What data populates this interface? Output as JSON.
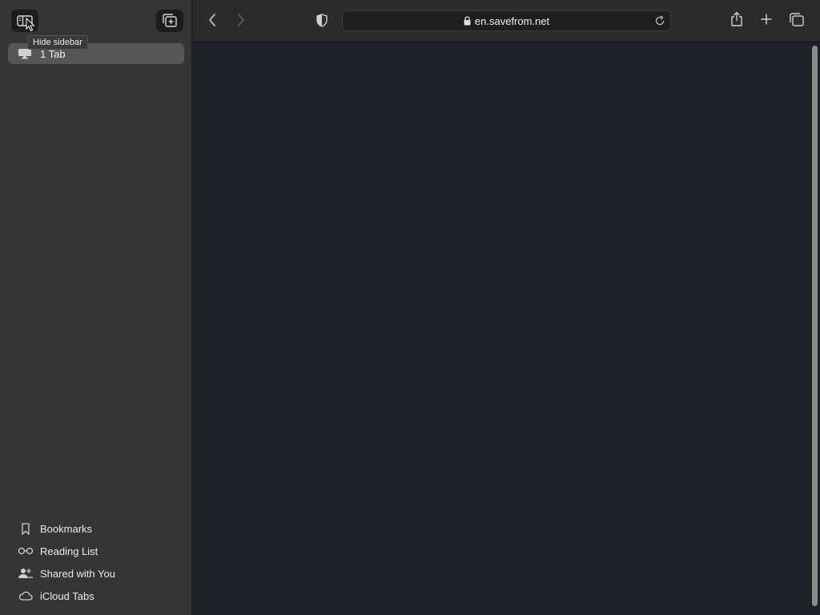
{
  "sidebar": {
    "tooltip": "Hide sidebar",
    "tab_group_label": "1 Tab",
    "items": [
      {
        "label": "Bookmarks",
        "icon": "bookmark-icon"
      },
      {
        "label": "Reading List",
        "icon": "reading-list-icon"
      },
      {
        "label": "Shared with You",
        "icon": "shared-with-you-icon"
      },
      {
        "label": "iCloud Tabs",
        "icon": "icloud-icon"
      }
    ]
  },
  "toolbar": {
    "address": "en.savefrom.net"
  },
  "colors": {
    "sidebar_bg": "#353535",
    "toolbar_bg": "#2b2b2b",
    "content_bg": "#1f2129",
    "selected_tab_group": "#565656"
  }
}
